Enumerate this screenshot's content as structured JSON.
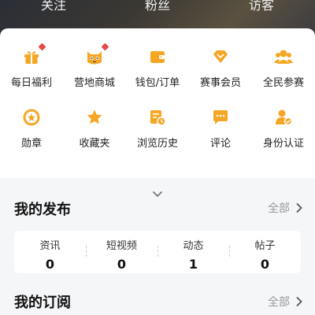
{
  "top_tabs": [
    {
      "label": "关注"
    },
    {
      "label": "粉丝"
    },
    {
      "label": "访客"
    }
  ],
  "grid": [
    {
      "label": "每日福利",
      "icon": "gift-icon",
      "badge": true
    },
    {
      "label": "营地商城",
      "icon": "mascot-shop-icon",
      "badge": true
    },
    {
      "label": "钱包/订单",
      "icon": "wallet-icon",
      "badge": false
    },
    {
      "label": "赛事会员",
      "icon": "diamond-icon",
      "badge": false
    },
    {
      "label": "全民参赛",
      "icon": "people-icon",
      "badge": false
    },
    {
      "label": "勋章",
      "icon": "medal-icon",
      "badge": false
    },
    {
      "label": "收藏夹",
      "icon": "star-icon",
      "badge": false
    },
    {
      "label": "浏览历史",
      "icon": "history-icon",
      "badge": false
    },
    {
      "label": "评论",
      "icon": "comment-icon",
      "badge": false
    },
    {
      "label": "身份认证",
      "icon": "verified-user-icon",
      "badge": false
    }
  ],
  "my_posts": {
    "title": "我的发布",
    "more": "全部",
    "stats": [
      {
        "label": "资讯",
        "value": "0"
      },
      {
        "label": "短视频",
        "value": "0"
      },
      {
        "label": "动态",
        "value": "1"
      },
      {
        "label": "帖子",
        "value": "0"
      }
    ]
  },
  "my_subscriptions": {
    "title": "我的订阅",
    "more": "全部"
  },
  "colors": {
    "accent": "#f5a623",
    "badge": "#e84a4a",
    "muted": "#999999"
  }
}
